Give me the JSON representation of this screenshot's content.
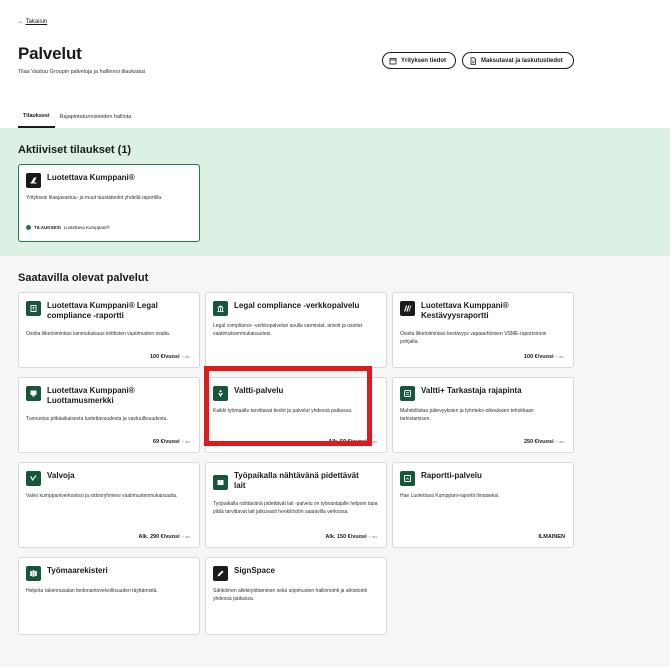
{
  "header": {
    "back_label": "Takaisin",
    "title": "Palvelut",
    "subtitle": "Tilaa Vastuu Groupin palveluja ja hallinnoi tilauksiasi",
    "btn_company": "Yrityksen tiedot",
    "btn_payment": "Maksutavat ja laskutustiedot"
  },
  "tabs": [
    "Tilauksesi",
    "Rajapintatunnisteiden hallinta"
  ],
  "active_section": {
    "title": "Aktiiviset tilaukset (1)",
    "card": {
      "name": "Luotettava Kumppani®",
      "desc": "Yrityksesi tilaajavastuu- ja muut taustatiedot yhdellä raportilla.",
      "status_label": "TILAUKSESI",
      "status_value": "Luotettava Kumppani®"
    }
  },
  "available_section": {
    "title": "Saatavilla olevat palvelut",
    "cards": [
      {
        "name": "Luotettava Kumppani® Legal compliance -raportti",
        "desc": "Osoita liiketoimintasi lainmukaisuus kriittisten vaatimusten osalta.",
        "price": "100 €/vuosi",
        "vat": "+ alv."
      },
      {
        "name": "Legal compliance -verkkopalvelu",
        "desc": "Legal compliance -verkkopalvelun avulla varmistat, arvioit ja osoitat vaatimuksenmukaisuutesi.",
        "price": "",
        "vat": ""
      },
      {
        "name": "Luotettava Kumppani® Kestävyysraportti",
        "desc": "Osoita liiketoimintasi kestävyys vapaaehtoisen VSME-raportoinnin pohjalta.",
        "price": "100 €/vuosi",
        "vat": "+ alv."
      },
      {
        "name": "Luotettava Kumppani® Luottamusmerkki",
        "desc": "Tunnustus pitkäaikaisesta luotettavuudesta ja vastuullisuudesta.",
        "price": "69 €/vuosi",
        "vat": "+ alv."
      },
      {
        "name": "Valtti-palvelu",
        "desc": "Kaikki työmaalle tarvittavat tiedot ja palvelut yhdessä paikassa.",
        "price": "Alk. 50 €/vuosi",
        "vat": "+ alv."
      },
      {
        "name": "Valtti+ Tarkastaja rajapinta",
        "desc": "Mahdollistaa pätevyyksien ja työnteko-oikeuksien tehokkaan tarkistamisen.",
        "price": "250 €/vuosi",
        "vat": "+ alv."
      },
      {
        "name": "Valvoja",
        "desc": "Valvo kumppaniverkostosi ja sidosryhmiesi vaatimustenmukaisuutta.",
        "price": "Alk. 290 €/vuosi",
        "vat": "+ alv."
      },
      {
        "name": "Työpaikalla nähtävänä pidettävät lait",
        "desc": "Työpaikalla nähtävänä pidettävät lait -palvelu on työnantajalle helpoin tapa pitää tarvittavat lait jatkuvasti henkilöstön saatavilla verkossa.",
        "price": "Alk. 150 €/vuosi",
        "vat": "+ alv."
      },
      {
        "name": "Raportti-palvelu",
        "desc": "Hae Luotettava Kumppani-raportit ilmaiseksi.",
        "price": "ILMAINEN",
        "vat": ""
      },
      {
        "name": "Työmaarekisteri",
        "desc": "Helpota rakennusalan tiedonantovelvollisuuden täyttämistä.",
        "price": "",
        "vat": ""
      },
      {
        "name": "SignSpace",
        "desc": "Sähköinen allekirjoittaminen sekä sopimusten hallinnointi ja arkistointi yhdessä paikassa.",
        "price": "",
        "vat": ""
      }
    ]
  },
  "colors": {
    "accent_green": "#16563a",
    "band": "#dcf0e4",
    "highlight": "#e0191b"
  }
}
